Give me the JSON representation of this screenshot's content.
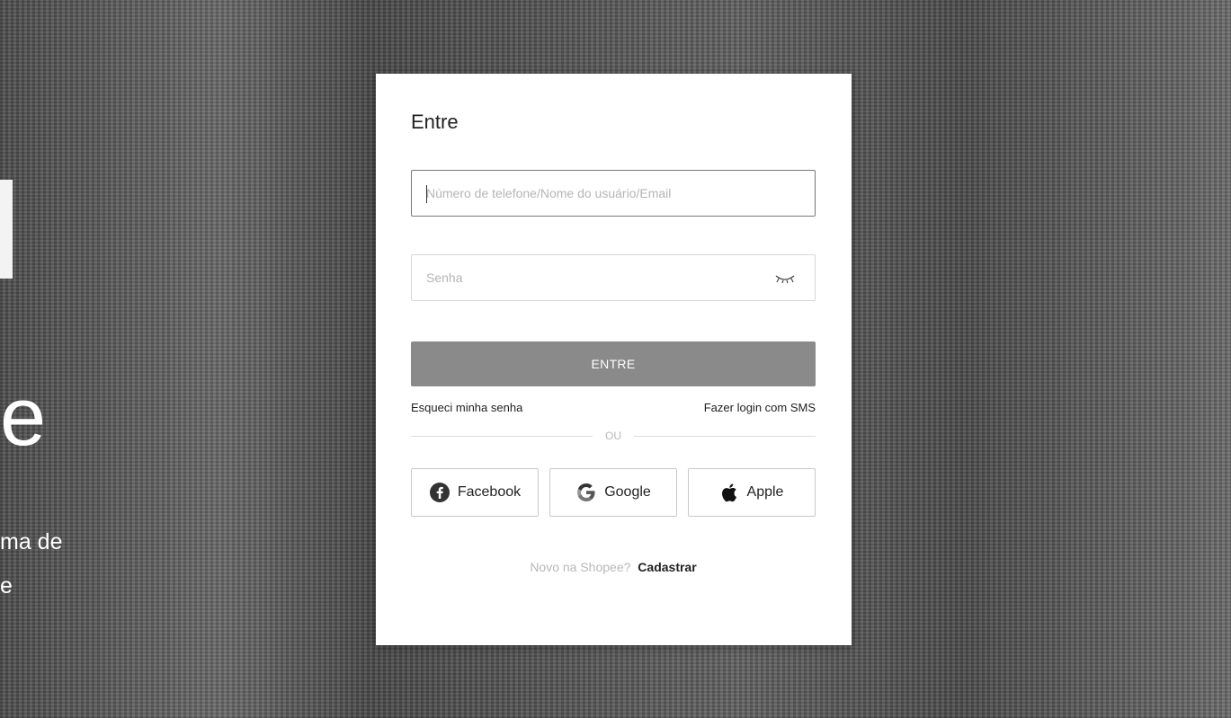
{
  "background": {
    "big_letter": "e",
    "line1": "ma de",
    "line2": "e"
  },
  "modal": {
    "title": "Entre",
    "username_placeholder": "Número de telefone/Nome do usuário/Email",
    "password_placeholder": "Senha",
    "submit_label": "ENTRE",
    "forgot_label": "Esqueci minha senha",
    "sms_label": "Fazer login com SMS",
    "divider_label": "OU",
    "social": [
      {
        "label": "Facebook",
        "icon": "facebook-icon"
      },
      {
        "label": "Google",
        "icon": "google-icon"
      },
      {
        "label": "Apple",
        "icon": "apple-icon"
      }
    ],
    "signup_prompt": "Novo na Shopee?",
    "signup_link": "Cadastrar"
  },
  "colors": {
    "submit_bg": "#8a8a8a",
    "focused_border": "#777777"
  }
}
